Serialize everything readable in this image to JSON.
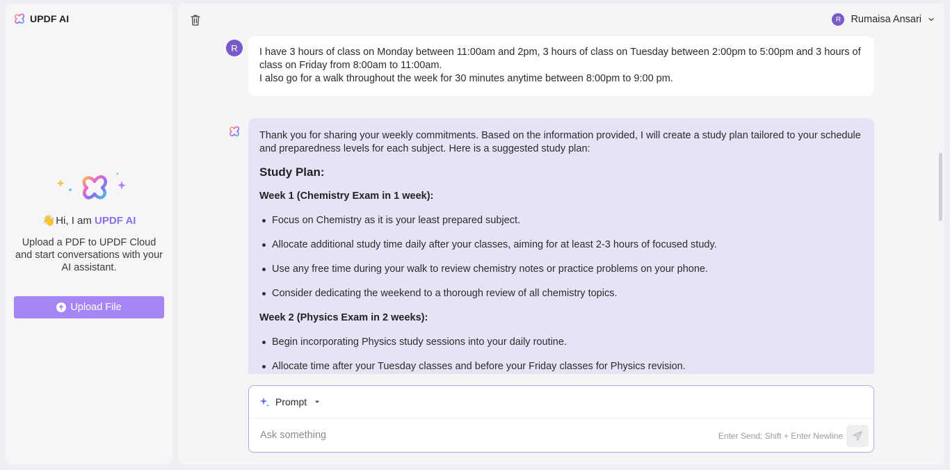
{
  "app": {
    "name": "UPDF AI",
    "logo_icon": "updf-logo-icon"
  },
  "sidebar": {
    "wave_emoji": "👋",
    "greeting_prefix": "Hi, I am ",
    "greeting_brand": "UPDF AI",
    "intro": "Upload a PDF to UPDF Cloud and start conversations with your AI assistant.",
    "upload_label": "Upload File"
  },
  "header": {
    "user_initial": "R",
    "user_name": "Rumaisa Ansari"
  },
  "chat": {
    "user_message": {
      "avatar": "R",
      "line1": "I have 3 hours of class on Monday between 11:00am and 2pm, 3 hours of class on Tuesday between 2:00pm to 5:00pm and 3 hours of class on Friday from 8:00am to 11:00am.",
      "line2": "I also go for a walk throughout the week for 30 minutes anytime between 8:00pm to 9:00 pm."
    },
    "ai_message": {
      "intro": "Thank you for sharing your weekly commitments. Based on the information provided, I will create a study plan tailored to your schedule and preparedness levels for each subject. Here is a suggested study plan:",
      "heading": "Study Plan:",
      "week1_title": "Week 1 (Chemistry Exam in 1 week):",
      "week1_items": [
        "Focus on Chemistry as it is your least prepared subject.",
        "Allocate additional study time daily after your classes, aiming for at least 2-3 hours of focused study.",
        "Use any free time during your walk to review chemistry notes or practice problems on your phone.",
        "Consider dedicating the weekend to a thorough review of all chemistry topics."
      ],
      "week2_title": "Week 2 (Physics Exam in 2 weeks):",
      "week2_items": [
        "Begin incorporating Physics study sessions into your daily routine.",
        "Allocate time after your Tuesday classes and before your Friday classes for Physics revision."
      ]
    }
  },
  "composer": {
    "prompt_label": "Prompt",
    "placeholder": "Ask something",
    "hint": "Enter Send; Shift + Enter Newline"
  },
  "colors": {
    "accent": "#a686f5",
    "brand_text": "#8a6fe8",
    "avatar": "#7a59c8",
    "ai_bubble": "#e6e3f7",
    "composer_border": "#b7a6ec"
  }
}
